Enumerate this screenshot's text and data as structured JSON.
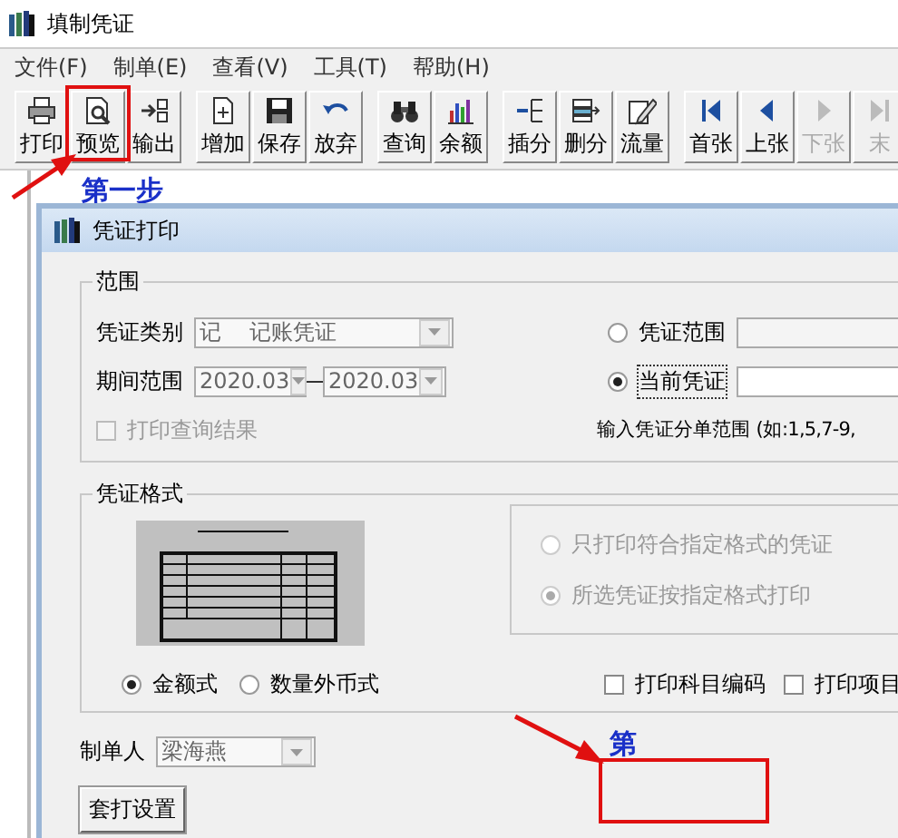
{
  "window": {
    "title": "填制凭证"
  },
  "menu": [
    "文件(F)",
    "制单(E)",
    "查看(V)",
    "工具(T)",
    "帮助(H)"
  ],
  "toolbar_groups": [
    {
      "buttons": [
        {
          "kind": "print",
          "label": "打印",
          "disabled": false
        },
        {
          "kind": "preview",
          "label": "预览",
          "disabled": false
        },
        {
          "kind": "export",
          "label": "输出",
          "disabled": false
        }
      ]
    },
    {
      "buttons": [
        {
          "kind": "add",
          "label": "增加",
          "disabled": false
        },
        {
          "kind": "save",
          "label": "保存",
          "disabled": false
        },
        {
          "kind": "undo",
          "label": "放弃",
          "disabled": false
        }
      ]
    },
    {
      "buttons": [
        {
          "kind": "search",
          "label": "查询",
          "disabled": false
        },
        {
          "kind": "chart",
          "label": "余额",
          "disabled": false
        }
      ]
    },
    {
      "buttons": [
        {
          "kind": "insert",
          "label": "插分",
          "disabled": false
        },
        {
          "kind": "delete",
          "label": "删分",
          "disabled": false
        },
        {
          "kind": "flow",
          "label": "流量",
          "disabled": false
        }
      ]
    },
    {
      "buttons": [
        {
          "kind": "first",
          "label": "首张",
          "disabled": false
        },
        {
          "kind": "prev",
          "label": "上张",
          "disabled": false
        },
        {
          "kind": "next",
          "label": "下张",
          "disabled": true
        },
        {
          "kind": "last",
          "label": "末",
          "disabled": true
        }
      ]
    }
  ],
  "annotations": [
    {
      "kind": "step",
      "text": "第一步"
    },
    {
      "kind": "step",
      "text": "第"
    }
  ],
  "dialog": {
    "title": "凭证打印",
    "range": {
      "title": "范围",
      "voucher_type": {
        "label": "凭证类别",
        "value": "记    记账凭证"
      },
      "period": {
        "label": "期间范围",
        "from": "2020.03",
        "to": "2020.03"
      },
      "print_query": {
        "label": "打印查询结果",
        "checked": false,
        "disabled": true
      },
      "modes": [
        {
          "label": "凭证范围",
          "selected": false
        },
        {
          "label": "当前凭证",
          "selected": true
        }
      ],
      "hint": "输入凭证分单范围 (如:1,5,7-9,"
    },
    "format": {
      "title": "凭证格式",
      "options_disabled": true,
      "options": [
        {
          "label": "只打印符合指定格式的凭证",
          "selected": false
        },
        {
          "label": "所选凭证按指定格式打印",
          "selected": true
        }
      ],
      "styles": [
        {
          "label": "金额式",
          "selected": true
        },
        {
          "label": "数量外币式",
          "selected": false
        }
      ],
      "checks": [
        {
          "label": "打印科目编码",
          "checked": false
        },
        {
          "label": "打印项目",
          "checked": false
        }
      ]
    },
    "maker": {
      "label": "制单人",
      "value": "梁海燕"
    },
    "buttons": [
      "套打设置"
    ]
  }
}
